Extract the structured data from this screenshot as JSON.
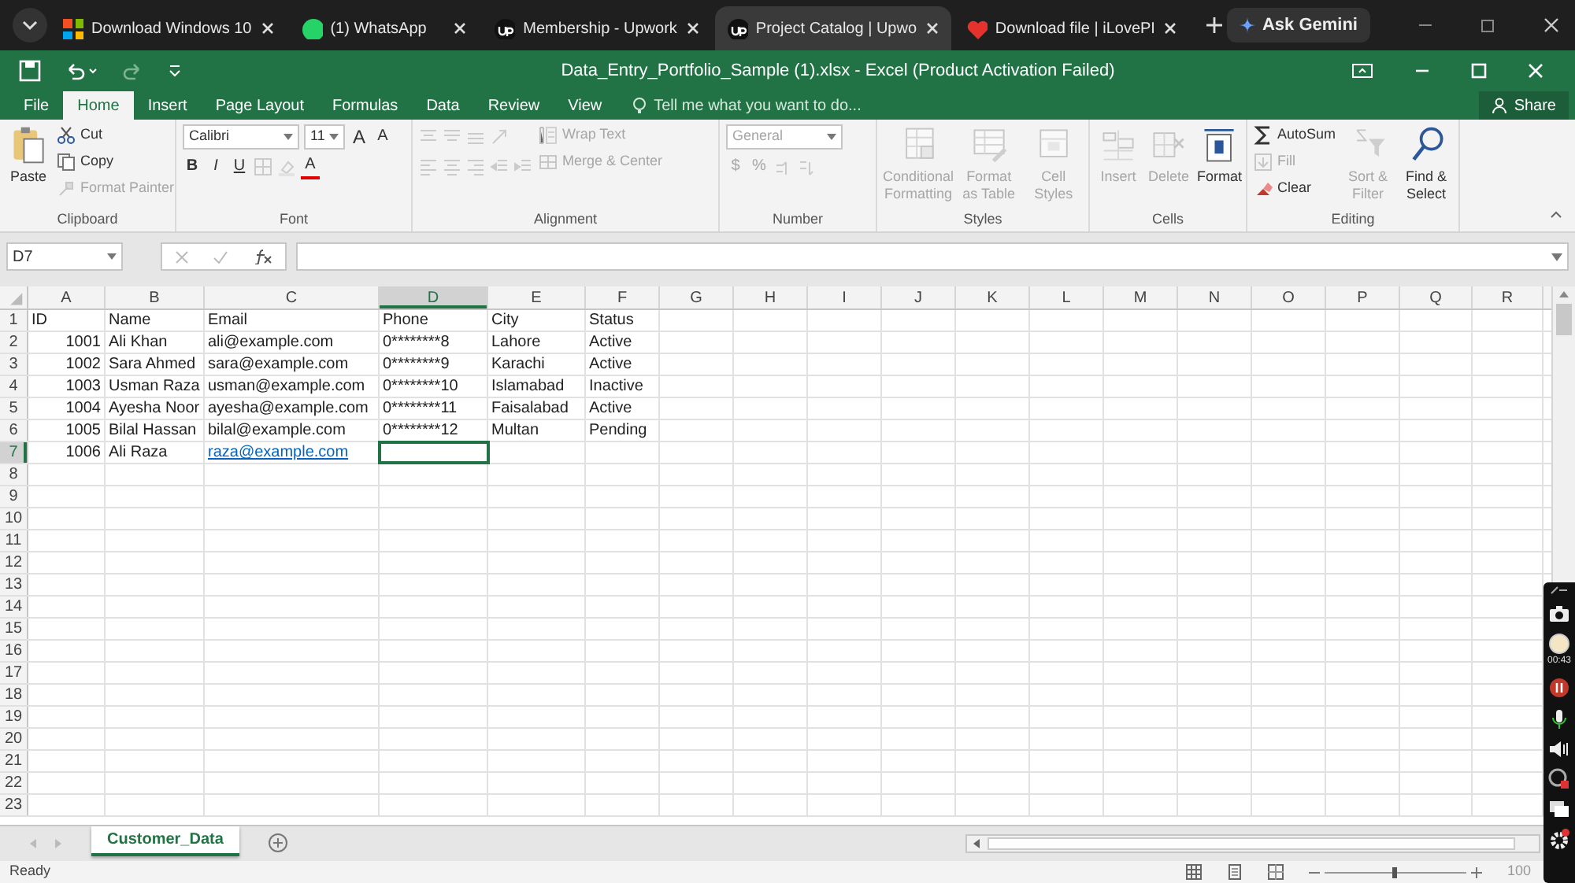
{
  "browser_tabs": [
    {
      "title": "Download Windows 10",
      "selected": false
    },
    {
      "title": "(1) WhatsApp",
      "selected": false
    },
    {
      "title": "Membership - Upwork",
      "selected": false
    },
    {
      "title": "Project Catalog | Upwo",
      "selected": true
    },
    {
      "title": "Download file | iLovePI",
      "selected": false
    }
  ],
  "ask_gemini": "Ask Gemini",
  "window": {
    "title": "Data_Entry_Portfolio_Sample (1).xlsx - Excel (Product Activation Failed)"
  },
  "ribbon_tabs": [
    {
      "label": "File",
      "selected": false
    },
    {
      "label": "Home",
      "selected": true
    },
    {
      "label": "Insert",
      "selected": false
    },
    {
      "label": "Page Layout",
      "selected": false
    },
    {
      "label": "Formulas",
      "selected": false
    },
    {
      "label": "Data",
      "selected": false
    },
    {
      "label": "Review",
      "selected": false
    },
    {
      "label": "View",
      "selected": false
    }
  ],
  "tell_me": {
    "placeholder": "Tell me what you want to do..."
  },
  "share": "Share",
  "ribbon_groups": [
    {
      "name": "Clipboard",
      "columns": [
        [
          {
            "kind": "large",
            "label": "Paste",
            "disabled": false
          }
        ],
        [
          {
            "kind": "small",
            "label": "Cut",
            "disabled": false
          },
          {
            "kind": "small",
            "label": "Copy",
            "disabled": false
          },
          {
            "kind": "small",
            "label": "Format Painter",
            "disabled": true
          }
        ]
      ]
    },
    {
      "name": "Font",
      "columns": [
        [
          {
            "kind": "row",
            "items": [
              {
                "kind": "select",
                "label": "Calibri",
                "disabled": false
              },
              {
                "kind": "select",
                "label": "11",
                "disabled": false
              },
              {
                "kind": "glyph",
                "label": "A",
                "disabled": false
              },
              {
                "kind": "glyph",
                "label": "A",
                "disabled": false
              }
            ]
          },
          {
            "kind": "row",
            "items": [
              {
                "kind": "glyph",
                "label": "B",
                "disabled": false
              },
              {
                "kind": "glyph",
                "label": "I",
                "disabled": false
              },
              {
                "kind": "glyph",
                "label": "U",
                "disabled": false
              },
              {
                "kind": "icon",
                "disabled": true
              },
              {
                "kind": "icon",
                "disabled": true
              },
              {
                "kind": "glyph",
                "label": "A",
                "disabled": false
              }
            ]
          }
        ]
      ]
    },
    {
      "name": "Alignment",
      "columns": [
        [
          {
            "kind": "row",
            "items": [
              {
                "kind": "icon",
                "disabled": true
              },
              {
                "kind": "icon",
                "disabled": true
              },
              {
                "kind": "icon",
                "disabled": true
              },
              {
                "kind": "icon",
                "disabled": true
              }
            ]
          },
          {
            "kind": "row",
            "items": [
              {
                "kind": "icon",
                "disabled": true
              },
              {
                "kind": "icon",
                "disabled": true
              },
              {
                "kind": "icon",
                "disabled": true
              },
              {
                "kind": "icon",
                "disabled": true
              },
              {
                "kind": "icon",
                "disabled": true
              }
            ]
          }
        ],
        [
          {
            "kind": "small",
            "label": "Wrap Text",
            "disabled": true
          },
          {
            "kind": "small",
            "label": "Merge & Center",
            "disabled": true
          }
        ]
      ]
    },
    {
      "name": "Number",
      "columns": [
        [
          {
            "kind": "select",
            "label": "General",
            "disabled": true
          },
          {
            "kind": "row",
            "items": [
              {
                "kind": "glyph",
                "label": "$",
                "disabled": true
              },
              {
                "kind": "glyph",
                "label": "%",
                "disabled": true
              },
              {
                "kind": "icon",
                "disabled": true
              },
              {
                "kind": "icon",
                "disabled": true
              }
            ]
          }
        ]
      ]
    },
    {
      "name": "Styles",
      "columns": [
        [
          {
            "kind": "large",
            "label": "Conditional Formatting",
            "disabled": true
          }
        ],
        [
          {
            "kind": "large",
            "label": "Format as Table",
            "disabled": true
          }
        ],
        [
          {
            "kind": "large",
            "label": "Cell Styles",
            "disabled": true
          }
        ]
      ]
    },
    {
      "name": "Cells",
      "columns": [
        [
          {
            "kind": "large",
            "label": "Insert",
            "disabled": true
          }
        ],
        [
          {
            "kind": "large",
            "label": "Delete",
            "disabled": true
          }
        ],
        [
          {
            "kind": "large",
            "label": "Format",
            "disabled": false
          }
        ]
      ]
    },
    {
      "name": "Editing",
      "columns": [
        [
          {
            "kind": "small",
            "label": "AutoSum",
            "disabled": false
          },
          {
            "kind": "small",
            "label": "Fill",
            "disabled": true
          },
          {
            "kind": "small",
            "label": "Clear",
            "disabled": false
          }
        ],
        [
          {
            "kind": "large",
            "label": "Sort & Filter",
            "disabled": true
          }
        ],
        [
          {
            "kind": "large",
            "label": "Find & Select",
            "disabled": false
          }
        ]
      ]
    }
  ],
  "name_box": "D7",
  "columns": [
    {
      "letter": "A",
      "selected": false
    },
    {
      "letter": "B",
      "selected": false
    },
    {
      "letter": "C",
      "selected": false
    },
    {
      "letter": "D",
      "selected": true
    },
    {
      "letter": "E",
      "selected": false
    },
    {
      "letter": "F",
      "selected": false
    },
    {
      "letter": "G",
      "selected": false
    },
    {
      "letter": "H",
      "selected": false
    },
    {
      "letter": "I",
      "selected": false
    },
    {
      "letter": "J",
      "selected": false
    },
    {
      "letter": "K",
      "selected": false
    },
    {
      "letter": "L",
      "selected": false
    },
    {
      "letter": "M",
      "selected": false
    },
    {
      "letter": "N",
      "selected": false
    },
    {
      "letter": "O",
      "selected": false
    },
    {
      "letter": "P",
      "selected": false
    },
    {
      "letter": "Q",
      "selected": false
    },
    {
      "letter": "R",
      "selected": false
    }
  ],
  "rows": [
    {
      "number": "1",
      "selected": false,
      "cells": [
        {
          "text": "ID",
          "kind": "text"
        },
        {
          "text": "Name",
          "kind": "text"
        },
        {
          "text": "Email",
          "kind": "text"
        },
        {
          "text": "Phone",
          "kind": "text"
        },
        {
          "text": "City",
          "kind": "text"
        },
        {
          "text": "Status",
          "kind": "text"
        }
      ]
    },
    {
      "number": "2",
      "selected": false,
      "cells": [
        {
          "text": "1001",
          "kind": "number"
        },
        {
          "text": "Ali Khan",
          "kind": "text"
        },
        {
          "text": "ali@example.com",
          "kind": "text"
        },
        {
          "text": "0********8",
          "kind": "text"
        },
        {
          "text": "Lahore",
          "kind": "text"
        },
        {
          "text": "Active",
          "kind": "text"
        }
      ]
    },
    {
      "number": "3",
      "selected": false,
      "cells": [
        {
          "text": "1002",
          "kind": "number"
        },
        {
          "text": "Sara Ahmed",
          "kind": "text"
        },
        {
          "text": "sara@example.com",
          "kind": "text"
        },
        {
          "text": "0********9",
          "kind": "text"
        },
        {
          "text": "Karachi",
          "kind": "text"
        },
        {
          "text": "Active",
          "kind": "text"
        }
      ]
    },
    {
      "number": "4",
      "selected": false,
      "cells": [
        {
          "text": "1003",
          "kind": "number"
        },
        {
          "text": "Usman Raza",
          "kind": "text"
        },
        {
          "text": "usman@example.com",
          "kind": "text"
        },
        {
          "text": "0********10",
          "kind": "text"
        },
        {
          "text": "Islamabad",
          "kind": "text"
        },
        {
          "text": "Inactive",
          "kind": "text"
        }
      ]
    },
    {
      "number": "5",
      "selected": false,
      "cells": [
        {
          "text": "1004",
          "kind": "number"
        },
        {
          "text": "Ayesha Noor",
          "kind": "text"
        },
        {
          "text": "ayesha@example.com",
          "kind": "text"
        },
        {
          "text": "0********11",
          "kind": "text"
        },
        {
          "text": "Faisalabad",
          "kind": "text"
        },
        {
          "text": "Active",
          "kind": "text"
        }
      ]
    },
    {
      "number": "6",
      "selected": false,
      "cells": [
        {
          "text": "1005",
          "kind": "number"
        },
        {
          "text": "Bilal Hassan",
          "kind": "text"
        },
        {
          "text": "bilal@example.com",
          "kind": "text"
        },
        {
          "text": "0********12",
          "kind": "text"
        },
        {
          "text": "Multan",
          "kind": "text"
        },
        {
          "text": "Pending",
          "kind": "text"
        }
      ]
    },
    {
      "number": "7",
      "selected": true,
      "cells": [
        {
          "text": "1006",
          "kind": "number"
        },
        {
          "text": "Ali Raza",
          "kind": "text"
        },
        {
          "text": "raza@example.com",
          "kind": "link"
        }
      ]
    },
    {
      "number": "8",
      "selected": false
    },
    {
      "number": "9",
      "selected": false
    },
    {
      "number": "10",
      "selected": false
    },
    {
      "number": "11",
      "selected": false
    },
    {
      "number": "12",
      "selected": false
    },
    {
      "number": "13",
      "selected": false
    },
    {
      "number": "14",
      "selected": false
    },
    {
      "number": "15",
      "selected": false
    },
    {
      "number": "16",
      "selected": false
    },
    {
      "number": "17",
      "selected": false
    },
    {
      "number": "18",
      "selected": false
    },
    {
      "number": "19",
      "selected": false
    },
    {
      "number": "20",
      "selected": false
    },
    {
      "number": "21",
      "selected": false
    },
    {
      "number": "22",
      "selected": false
    },
    {
      "number": "23",
      "selected": false
    }
  ],
  "sheet_tabs": [
    {
      "label": "Customer_Data",
      "selected": true
    }
  ],
  "status_bar": {
    "text": "Ready",
    "zoom_slider": {
      "level": 0.5
    },
    "zoom": "100"
  },
  "recorder": {
    "timer": "00:43"
  }
}
